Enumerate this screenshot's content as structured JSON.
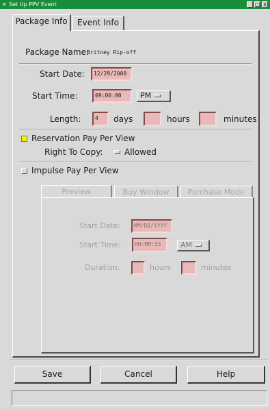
{
  "window": {
    "title": "Set Up PPV Event",
    "controls": [
      "_",
      "□",
      "x"
    ]
  },
  "tabs": [
    {
      "label": "Package Info",
      "active": true
    },
    {
      "label": "Event Info",
      "active": false
    }
  ],
  "package": {
    "name_label": "Package Name:",
    "name_value": "Britney Rip-off",
    "start_date_label": "Start Date:",
    "start_date_value": "12/29/2000",
    "start_time_label": "Start Time:",
    "start_time_value": "09:00:00",
    "ampm_value": "PM",
    "length_label": "Length:",
    "days_value": "4",
    "days_label": "days",
    "hours_value": "",
    "hours_label": "hours",
    "minutes_value": "",
    "minutes_label": "minutes"
  },
  "reservation": {
    "label": "Reservation Pay Per View",
    "checked": true,
    "right_to_copy_label": "Right To Copy:",
    "allowed_label": "Allowed"
  },
  "impulse": {
    "label": "Impulse Pay Per View",
    "checked": false,
    "subtabs": [
      {
        "label": "Preview",
        "active": true
      },
      {
        "label": "Buy Window",
        "active": false
      },
      {
        "label": "Purchase Mode",
        "active": false
      }
    ],
    "start_date_label": "Start Date:",
    "start_date_value": "MM/DD/YYYY",
    "start_time_label": "Start Time:",
    "start_time_value": "HH:MM:SS",
    "ampm_value": "AM",
    "duration_label": "Duration:",
    "hours_value": "",
    "hours_label": "hours",
    "minutes_value": "",
    "minutes_label": "minutes"
  },
  "buttons": {
    "save": "Save",
    "cancel": "Cancel",
    "help": "Help"
  },
  "status": {
    "text": ""
  },
  "colors": {
    "titlebar": "#188e3a",
    "field_bg": "#e9b8b8",
    "check_on": "#f4f400",
    "window_bg": "#d9d9d9"
  }
}
